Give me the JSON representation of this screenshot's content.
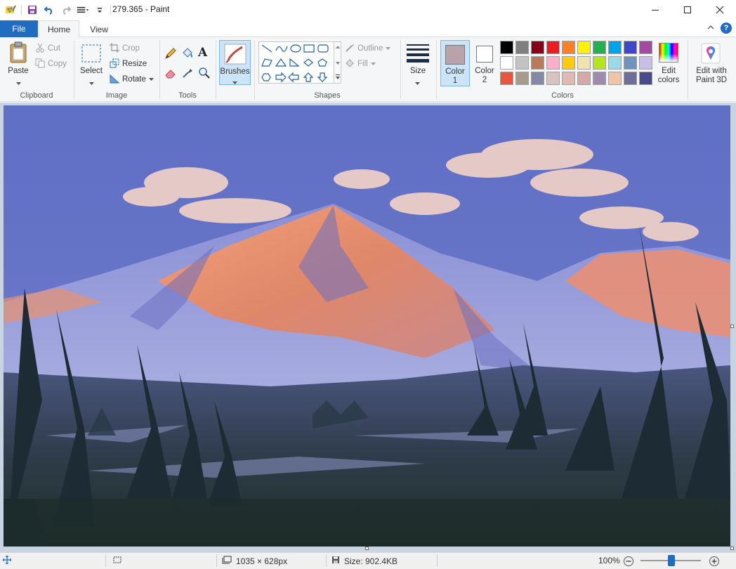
{
  "window": {
    "title": "279.365 - Paint"
  },
  "tabs": {
    "file": "File",
    "home": "Home",
    "view": "View"
  },
  "clipboard": {
    "paste": "Paste",
    "cut": "Cut",
    "copy": "Copy",
    "group": "Clipboard"
  },
  "image": {
    "select": "Select",
    "crop": "Crop",
    "resize": "Resize",
    "rotate": "Rotate",
    "group": "Image"
  },
  "tools": {
    "group": "Tools"
  },
  "brushes": {
    "label": "Brushes"
  },
  "shapes": {
    "outline": "Outline",
    "fill": "Fill",
    "group": "Shapes"
  },
  "size": {
    "label": "Size"
  },
  "colors": {
    "color1_label": "Color",
    "color1_num": "1",
    "color2_label": "Color",
    "color2_num": "2",
    "color1_value": "#b9a3ab",
    "color2_value": "#ffffff",
    "edit_label": "Edit",
    "edit_label2": "colors",
    "group": "Colors",
    "palette_row1": [
      "#000000",
      "#7f7f7f",
      "#880015",
      "#ed1c24",
      "#ff7f27",
      "#fff200",
      "#22b14c",
      "#00a2e8",
      "#3f48cc",
      "#a349a4"
    ],
    "palette_row2": [
      "#ffffff",
      "#c3c3c3",
      "#b97a57",
      "#ffaec9",
      "#ffc90e",
      "#efe4b0",
      "#b5e61d",
      "#99d9ea",
      "#7092be",
      "#c8bfe7"
    ],
    "palette_row3": [
      "#e9553b",
      "#a89a8c",
      "#8589a8",
      "#d9c3c0",
      "#e0bab2",
      "#d4a9a8",
      "#a08ab2",
      "#f0c4a6",
      "#6e6d9c",
      "#4a4b8c"
    ]
  },
  "paint3d": {
    "label1": "Edit with",
    "label2": "Paint 3D"
  },
  "status": {
    "dimensions": "1035 × 628px",
    "size": "Size: 902.4KB",
    "zoom": "100%"
  }
}
